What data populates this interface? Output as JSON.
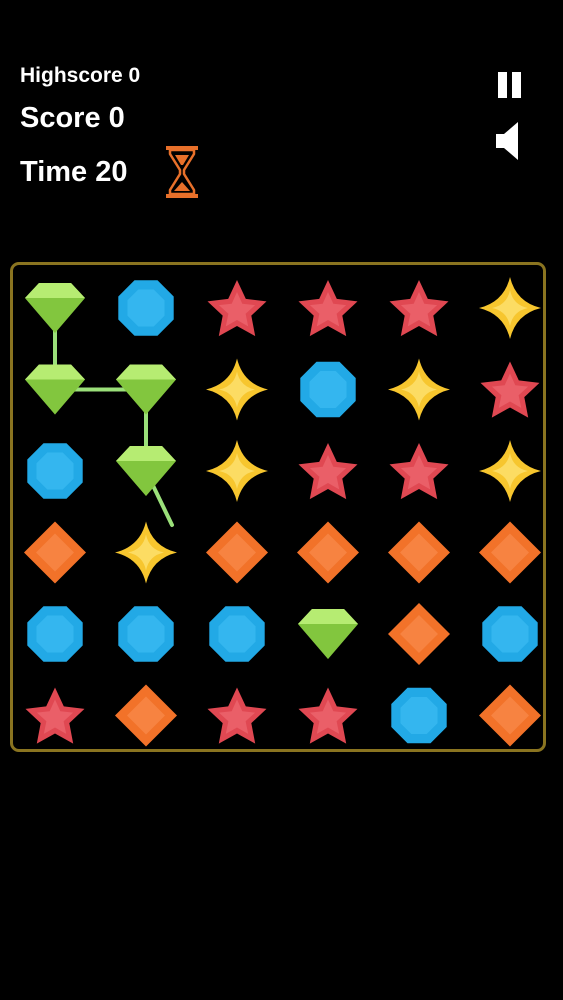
{
  "hud": {
    "highscore_text": "Highscore 0",
    "score_text": "Score 0",
    "time_text": "Time 20"
  },
  "icons": {
    "timer": "hourglass-icon",
    "pause": "pause-icon",
    "sound": "speaker-icon"
  },
  "colors": {
    "background": "#000000",
    "board_border": "#8a7420",
    "hourglass": "#e8702a",
    "connector_line": "#9be07a",
    "gem_green": "#8fd14a",
    "gem_blue": "#22a9e6",
    "gem_red": "#e04852",
    "gem_yellow": "#f7c62e",
    "gem_orange": "#f27229"
  },
  "board": {
    "rows": 6,
    "cols": 6,
    "grid": [
      [
        "green",
        "blue",
        "red",
        "red",
        "red",
        "yellow"
      ],
      [
        "green",
        "green",
        "yellow",
        "blue",
        "yellow",
        "red"
      ],
      [
        "blue",
        "green",
        "yellow",
        "red",
        "red",
        "yellow"
      ],
      [
        "orange",
        "yellow",
        "orange",
        "orange",
        "orange",
        "orange"
      ],
      [
        "blue",
        "blue",
        "blue",
        "green",
        "orange",
        "blue"
      ],
      [
        "red",
        "orange",
        "red",
        "red",
        "blue",
        "orange"
      ]
    ],
    "selected_path": [
      [
        0,
        0
      ],
      [
        1,
        0
      ],
      [
        1,
        1
      ],
      [
        2,
        1
      ]
    ],
    "drag_in_progress": true
  }
}
